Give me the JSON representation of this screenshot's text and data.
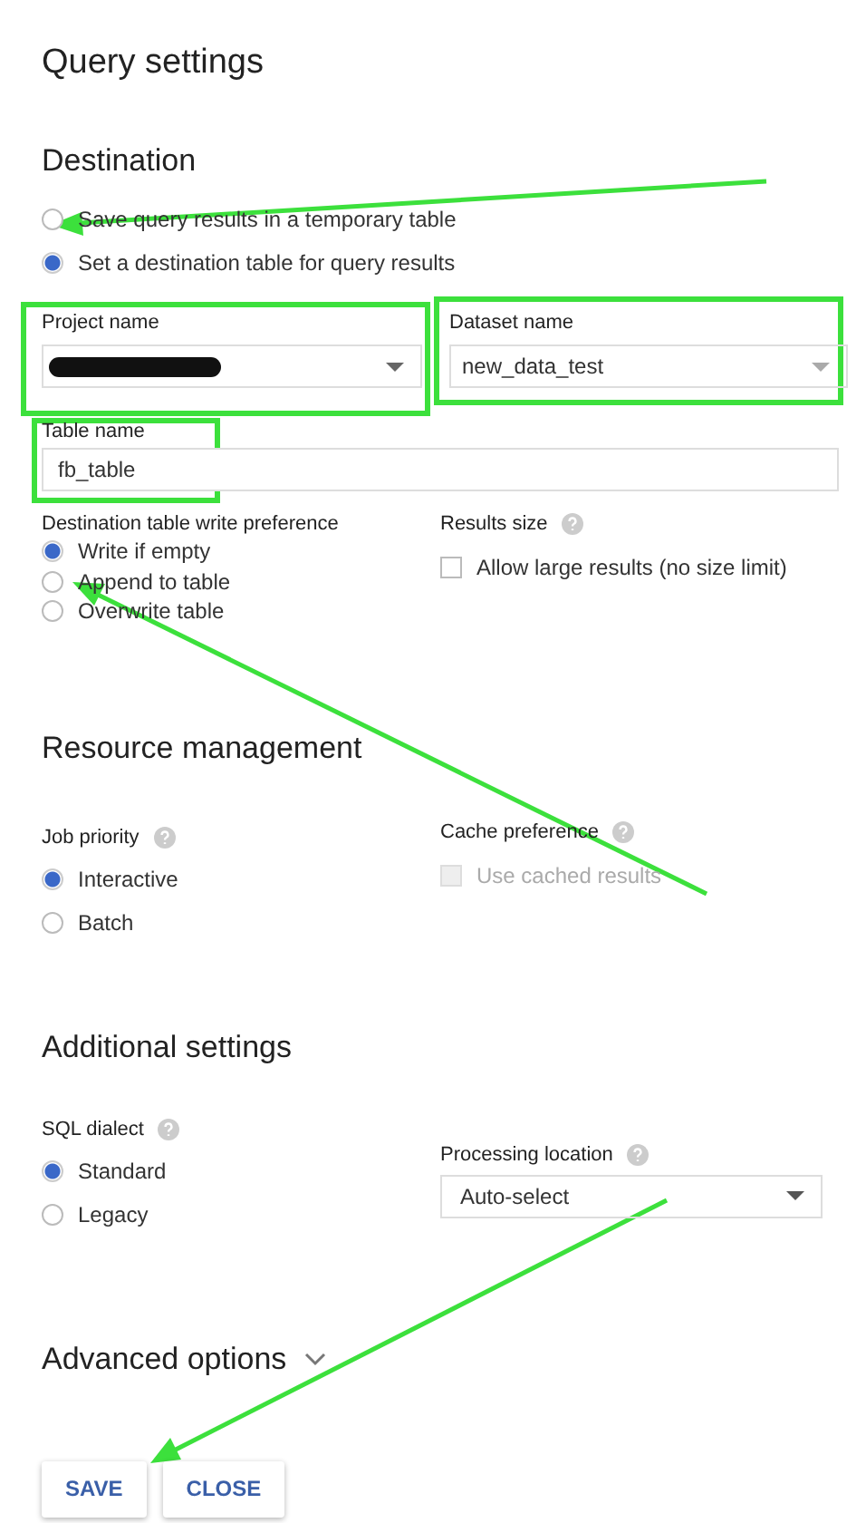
{
  "title": "Query settings",
  "destination": {
    "heading": "Destination",
    "options": [
      {
        "label": "Save query results in a temporary table",
        "selected": false
      },
      {
        "label": "Set a destination table for query results",
        "selected": true
      }
    ],
    "project": {
      "label": "Project name"
    },
    "dataset": {
      "label": "Dataset name",
      "value": "new_data_test"
    },
    "table": {
      "label": "Table name",
      "value": "fb_table"
    },
    "write_preference": {
      "label": "Destination table write preference",
      "options": [
        {
          "label": "Write if empty",
          "selected": true
        },
        {
          "label": "Append to table",
          "selected": false
        },
        {
          "label": "Overwrite table",
          "selected": false
        }
      ]
    },
    "results_size": {
      "label": "Results size",
      "checkbox": {
        "label": "Allow large results (no size limit)",
        "checked": false,
        "disabled": false
      }
    }
  },
  "resource": {
    "heading": "Resource management",
    "job_priority": {
      "label": "Job priority",
      "options": [
        {
          "label": "Interactive",
          "selected": true
        },
        {
          "label": "Batch",
          "selected": false
        }
      ]
    },
    "cache": {
      "label": "Cache preference",
      "checkbox": {
        "label": "Use cached results",
        "checked": false,
        "disabled": true
      }
    }
  },
  "additional": {
    "heading": "Additional settings",
    "sql_dialect": {
      "label": "SQL dialect",
      "options": [
        {
          "label": "Standard",
          "selected": true
        },
        {
          "label": "Legacy",
          "selected": false
        }
      ]
    },
    "location": {
      "label": "Processing location",
      "value": "Auto-select"
    }
  },
  "advanced": {
    "label": "Advanced options",
    "expanded": false
  },
  "buttons": [
    {
      "label": "SAVE"
    },
    {
      "label": "CLOSE"
    }
  ]
}
